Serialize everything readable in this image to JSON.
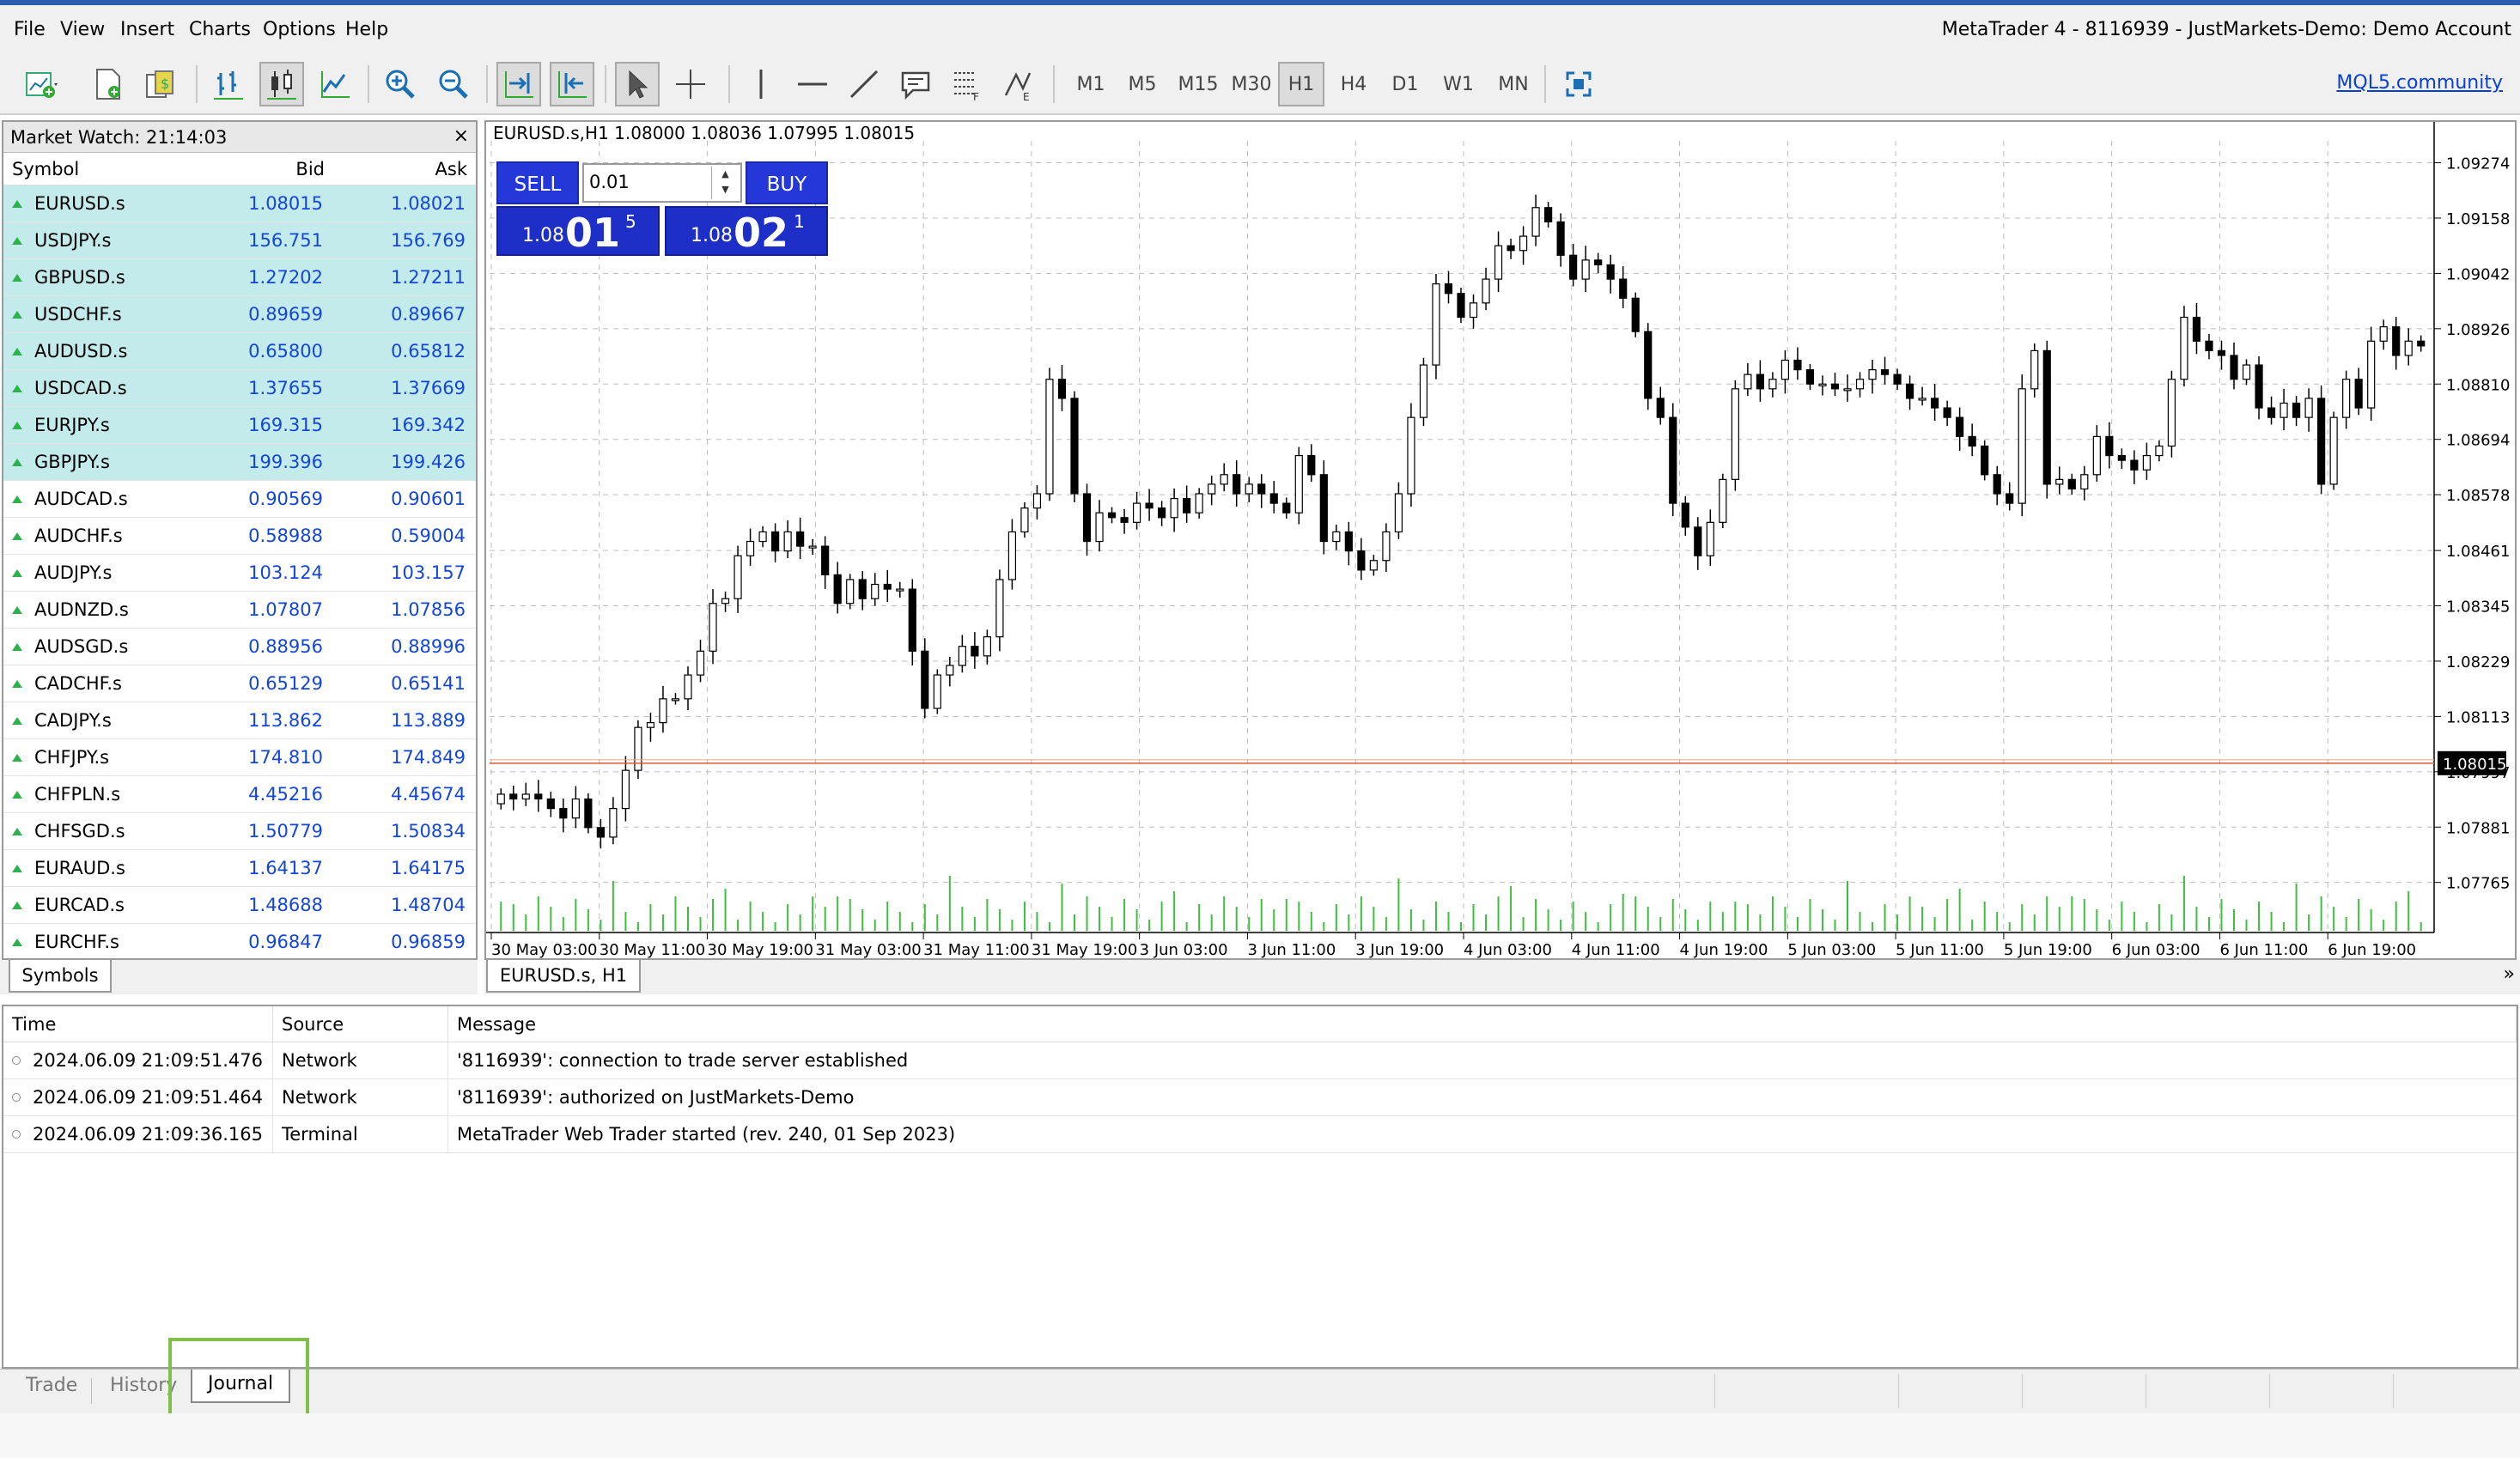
{
  "menu": [
    "File",
    "View",
    "Insert",
    "Charts",
    "Options",
    "Help"
  ],
  "window_title": "MetaTrader 4 - 8116939 - JustMarkets-Demo: Demo Account",
  "toolbar": {
    "timeframes": [
      "M1",
      "M5",
      "M15",
      "M30",
      "H1",
      "H4",
      "D1",
      "W1",
      "MN"
    ],
    "active_timeframe": "H1",
    "link": "MQL5.community"
  },
  "market_watch": {
    "title": "Market Watch: 21:14:03",
    "close": "×",
    "headers": {
      "symbol": "Symbol",
      "bid": "Bid",
      "ask": "Ask"
    },
    "rows": [
      {
        "symbol": "EURUSD.s",
        "bid": "1.08015",
        "ask": "1.08021",
        "hl": true
      },
      {
        "symbol": "USDJPY.s",
        "bid": "156.751",
        "ask": "156.769",
        "hl": true
      },
      {
        "symbol": "GBPUSD.s",
        "bid": "1.27202",
        "ask": "1.27211",
        "hl": true
      },
      {
        "symbol": "USDCHF.s",
        "bid": "0.89659",
        "ask": "0.89667",
        "hl": true
      },
      {
        "symbol": "AUDUSD.s",
        "bid": "0.65800",
        "ask": "0.65812",
        "hl": true
      },
      {
        "symbol": "USDCAD.s",
        "bid": "1.37655",
        "ask": "1.37669",
        "hl": true
      },
      {
        "symbol": "EURJPY.s",
        "bid": "169.315",
        "ask": "169.342",
        "hl": true
      },
      {
        "symbol": "GBPJPY.s",
        "bid": "199.396",
        "ask": "199.426",
        "hl": true
      },
      {
        "symbol": "AUDCAD.s",
        "bid": "0.90569",
        "ask": "0.90601",
        "hl": false
      },
      {
        "symbol": "AUDCHF.s",
        "bid": "0.58988",
        "ask": "0.59004",
        "hl": false
      },
      {
        "symbol": "AUDJPY.s",
        "bid": "103.124",
        "ask": "103.157",
        "hl": false
      },
      {
        "symbol": "AUDNZD.s",
        "bid": "1.07807",
        "ask": "1.07856",
        "hl": false
      },
      {
        "symbol": "AUDSGD.s",
        "bid": "0.88956",
        "ask": "0.88996",
        "hl": false
      },
      {
        "symbol": "CADCHF.s",
        "bid": "0.65129",
        "ask": "0.65141",
        "hl": false
      },
      {
        "symbol": "CADJPY.s",
        "bid": "113.862",
        "ask": "113.889",
        "hl": false
      },
      {
        "symbol": "CHFJPY.s",
        "bid": "174.810",
        "ask": "174.849",
        "hl": false
      },
      {
        "symbol": "CHFPLN.s",
        "bid": "4.45216",
        "ask": "4.45674",
        "hl": false
      },
      {
        "symbol": "CHFSGD.s",
        "bid": "1.50779",
        "ask": "1.50834",
        "hl": false
      },
      {
        "symbol": "EURAUD.s",
        "bid": "1.64137",
        "ask": "1.64175",
        "hl": false
      },
      {
        "symbol": "EURCAD.s",
        "bid": "1.48688",
        "ask": "1.48704",
        "hl": false
      },
      {
        "symbol": "EURCHF.s",
        "bid": "0.96847",
        "ask": "0.96859",
        "hl": false
      }
    ],
    "tab": "Symbols"
  },
  "trade_panel": {
    "sell": "SELL",
    "buy": "BUY",
    "volume": "0.01",
    "sell_price": {
      "prefix": "1.08",
      "big": "01",
      "sup": "5"
    },
    "buy_price": {
      "prefix": "1.08",
      "big": "02",
      "sup": "1"
    }
  },
  "chart_tab": "EURUSD.s, H1",
  "chart_more": "»",
  "chart_data": {
    "type": "candlestick",
    "header": "EURUSD.s,H1  1.08000 1.08036 1.07995 1.08015",
    "y_ticks": [
      "1.09274",
      "1.09158",
      "1.09042",
      "1.08926",
      "1.08810",
      "1.08694",
      "1.08578",
      "1.08461",
      "1.08345",
      "1.08229",
      "1.08113",
      "1.07997",
      "1.07881",
      "1.07765"
    ],
    "ylim": [
      1.0766,
      1.0932
    ],
    "current_price": 1.08015,
    "current_price_label": "1.08015",
    "x_ticks": [
      "30 May 03:00",
      "30 May 11:00",
      "30 May 19:00",
      "31 May 03:00",
      "31 May 11:00",
      "31 May 19:00",
      "3 Jun 03:00",
      "3 Jun 11:00",
      "3 Jun 19:00",
      "4 Jun 03:00",
      "4 Jun 11:00",
      "4 Jun 19:00",
      "5 Jun 03:00",
      "5 Jun 11:00",
      "5 Jun 19:00",
      "6 Jun 03:00",
      "6 Jun 11:00",
      "6 Jun 19:00"
    ],
    "close": [
      1.0795,
      1.0794,
      1.0795,
      1.0794,
      1.0792,
      1.079,
      1.0794,
      1.0788,
      1.0786,
      1.0792,
      1.08,
      1.0809,
      1.081,
      1.0815,
      1.0815,
      1.082,
      1.0825,
      1.0835,
      1.0836,
      1.0845,
      1.0848,
      1.085,
      1.0846,
      1.085,
      1.0847,
      1.0847,
      1.0841,
      1.0835,
      1.084,
      1.0836,
      1.0839,
      1.0838,
      1.0838,
      1.0825,
      1.0813,
      1.082,
      1.0822,
      1.0826,
      1.0824,
      1.0828,
      1.084,
      1.085,
      1.0855,
      1.0858,
      1.0882,
      1.0878,
      1.0858,
      1.0848,
      1.0854,
      1.0853,
      1.0852,
      1.0856,
      1.0855,
      1.0853,
      1.0857,
      1.0854,
      1.0858,
      1.086,
      1.0862,
      1.0858,
      1.086,
      1.0858,
      1.0856,
      1.0854,
      1.0866,
      1.0862,
      1.0848,
      1.085,
      1.0846,
      1.0842,
      1.0844,
      1.085,
      1.0858,
      1.0874,
      1.0885,
      1.0902,
      1.09,
      1.0895,
      1.0898,
      1.0903,
      1.091,
      1.0909,
      1.0912,
      1.0918,
      1.0915,
      1.0908,
      1.0903,
      1.0907,
      1.0906,
      1.0903,
      1.0899,
      1.0892,
      1.0878,
      1.0874,
      1.0856,
      1.0851,
      1.0845,
      1.0852,
      1.0861,
      1.088,
      1.0883,
      1.088,
      1.0882,
      1.0886,
      1.0884,
      1.0881,
      1.0881,
      1.088,
      1.088,
      1.0882,
      1.0884,
      1.0883,
      1.0881,
      1.0878,
      1.0878,
      1.0876,
      1.0874,
      1.087,
      1.0868,
      1.0862,
      1.0858,
      1.0856,
      1.088,
      1.0888,
      1.086,
      1.0861,
      1.0859,
      1.0862,
      1.087,
      1.0866,
      1.0865,
      1.0863,
      1.0866,
      1.0868,
      1.0882,
      1.0895,
      1.089,
      1.0888,
      1.0887,
      1.0882,
      1.0885,
      1.0876,
      1.0874,
      1.0877,
      1.0874,
      1.0878,
      1.086,
      1.0874,
      1.0882,
      1.0876,
      1.089,
      1.0893,
      1.0887,
      1.089,
      1.0889
    ],
    "volume_range": [
      1,
      10
    ]
  },
  "terminal": {
    "headers": {
      "time": "Time",
      "source": "Source",
      "message": "Message"
    },
    "rows": [
      {
        "time": "2024.06.09 21:09:51.476",
        "source": "Network",
        "message": "'8116939': connection to trade server established"
      },
      {
        "time": "2024.06.09 21:09:51.464",
        "source": "Network",
        "message": "'8116939': authorized on JustMarkets-Demo"
      },
      {
        "time": "2024.06.09 21:09:36.165",
        "source": "Terminal",
        "message": "MetaTrader Web Trader started (rev. 240, 01 Sep 2023)"
      }
    ]
  },
  "bottom_tabs": [
    "Trade",
    "History",
    "Journal"
  ],
  "active_bottom_tab": "Journal",
  "colors": {
    "accent": "#2437d8",
    "price_line": "#e25a3a",
    "up_arrow": "#2db14d",
    "highlight": "#c4ebec",
    "link": "#0a3fd6"
  }
}
